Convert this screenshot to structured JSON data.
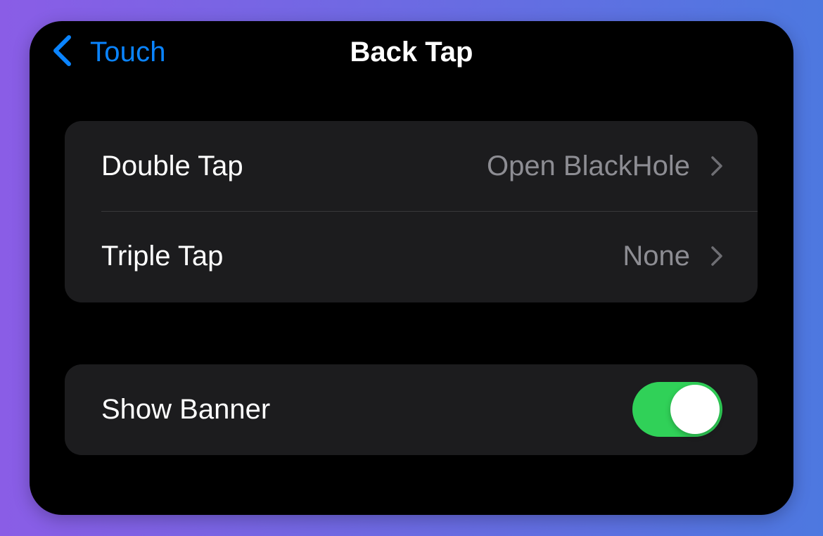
{
  "nav": {
    "back_icon": "chevron-left-icon",
    "back_label": "Touch",
    "title": "Back Tap"
  },
  "actions": {
    "rows": [
      {
        "label": "Double Tap",
        "value": "Open BlackHole",
        "icon": "chevron-right-icon"
      },
      {
        "label": "Triple Tap",
        "value": "None",
        "icon": "chevron-right-icon"
      }
    ]
  },
  "banner": {
    "label": "Show Banner",
    "toggle_on": true
  },
  "colors": {
    "accent": "#0a84ff",
    "toggle_on": "#30d158",
    "cell_bg": "#1c1c1e",
    "secondary_text": "#8d8d93"
  }
}
